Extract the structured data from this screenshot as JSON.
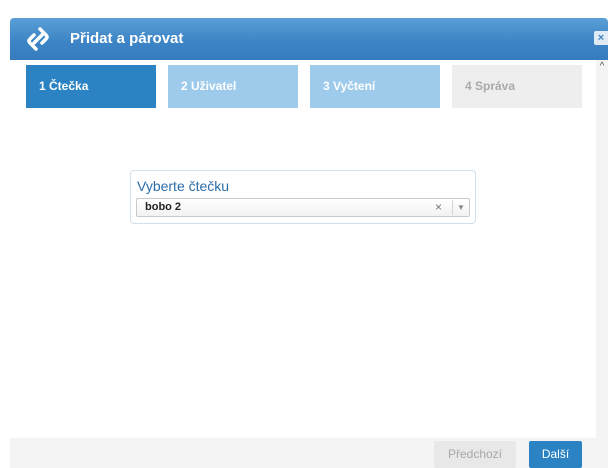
{
  "dialog": {
    "title": "Přidat a párovat",
    "title_icon": "link-icon",
    "close_label": "×"
  },
  "steps": [
    {
      "label": "1 Čtečka",
      "state": "active"
    },
    {
      "label": "2 Uživatel",
      "state": "pending"
    },
    {
      "label": "3 Vyčtení",
      "state": "pending"
    },
    {
      "label": "4 Správa",
      "state": "disabled"
    }
  ],
  "reader_select": {
    "label": "Vyberte čtečku",
    "value": "bobo 2",
    "clear_glyph": "×",
    "arrow_glyph": "▼"
  },
  "scrollbar": {
    "up_glyph": "^"
  },
  "footer": {
    "prev_label": "Předchozí",
    "next_label": "Další"
  },
  "colors": {
    "accent": "#2b83c3",
    "step_pending": "#9ecbeb",
    "step_disabled": "#eeeeee"
  }
}
